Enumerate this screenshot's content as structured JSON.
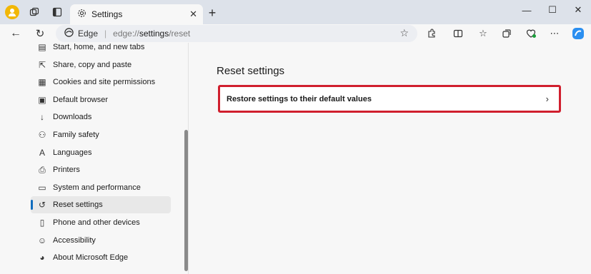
{
  "tab": {
    "title": "Settings",
    "close": "✕"
  },
  "new_tab": "+",
  "window_controls": {
    "minimize": "—",
    "maximize": "☐",
    "close": "✕"
  },
  "address_bar": {
    "site_label": "Edge",
    "separator": "|",
    "url_scheme": "edge://",
    "url_host": "settings",
    "url_path": "/reset"
  },
  "sidebar": {
    "items": [
      {
        "label": "Start, home, and new tabs",
        "icon": "start-home-icon",
        "glyph": "▤"
      },
      {
        "label": "Share, copy and paste",
        "icon": "share-icon",
        "glyph": "⇱"
      },
      {
        "label": "Cookies and site permissions",
        "icon": "cookies-icon",
        "glyph": "▦"
      },
      {
        "label": "Default browser",
        "icon": "default-browser-icon",
        "glyph": "▣"
      },
      {
        "label": "Downloads",
        "icon": "download-icon",
        "glyph": "↓"
      },
      {
        "label": "Family safety",
        "icon": "family-icon",
        "glyph": "⚇"
      },
      {
        "label": "Languages",
        "icon": "languages-icon",
        "glyph": "A"
      },
      {
        "label": "Printers",
        "icon": "printer-icon",
        "glyph": "⎙"
      },
      {
        "label": "System and performance",
        "icon": "system-icon",
        "glyph": "▭"
      },
      {
        "label": "Reset settings",
        "icon": "reset-icon",
        "glyph": "↺"
      },
      {
        "label": "Phone and other devices",
        "icon": "phone-icon",
        "glyph": "▯"
      },
      {
        "label": "Accessibility",
        "icon": "accessibility-icon",
        "glyph": "☺"
      },
      {
        "label": "About Microsoft Edge",
        "icon": "edge-icon",
        "glyph": "◕"
      }
    ],
    "active_index": 9
  },
  "main": {
    "title": "Reset settings",
    "restore_label": "Restore settings to their default values"
  },
  "colors": {
    "accent": "#0f6cbd",
    "highlight_border": "#d01f2e"
  }
}
